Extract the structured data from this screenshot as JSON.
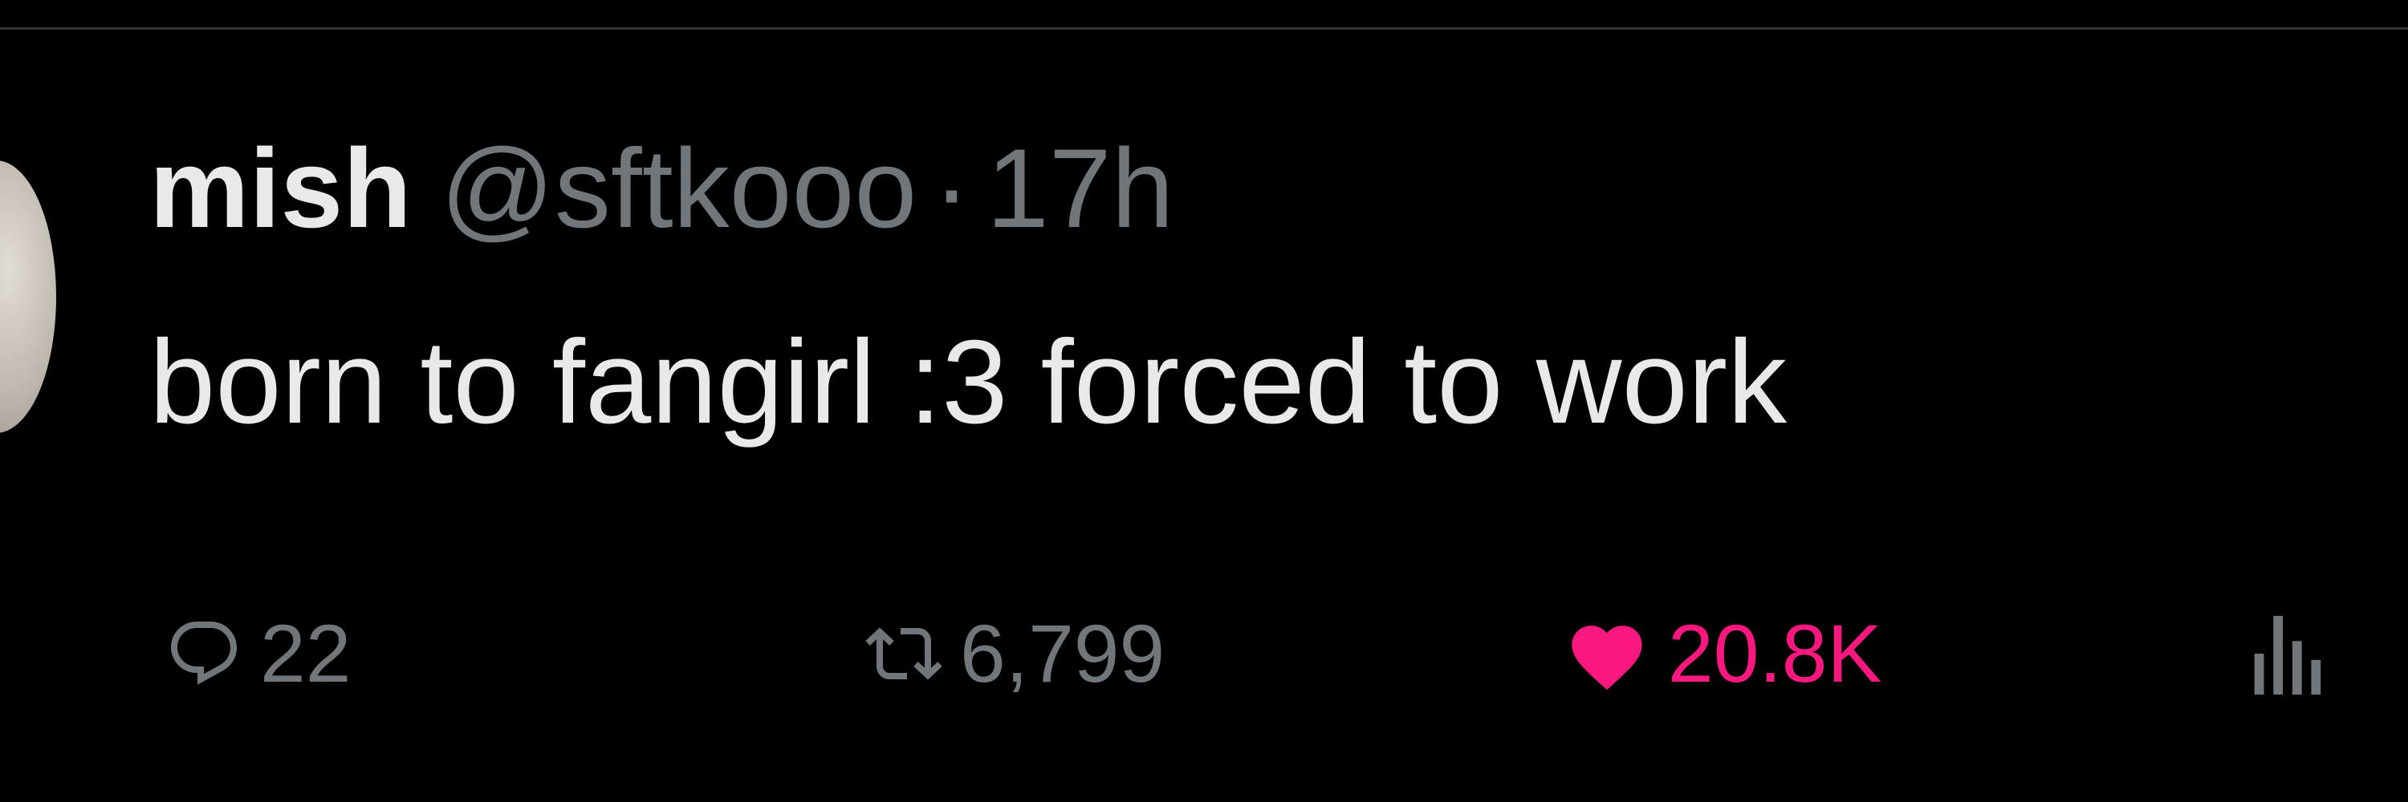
{
  "tweet": {
    "author": {
      "display_name": "mish",
      "handle": "@sftkooo"
    },
    "separator": "·",
    "timestamp": "17h",
    "text": "born to fangirl :3 forced to work"
  },
  "actions": {
    "reply": {
      "icon": "speech-bubble-icon",
      "count": "22"
    },
    "retweet": {
      "icon": "retweet-arrows-icon",
      "count": "6,799"
    },
    "like": {
      "icon": "heart-icon",
      "count": "20.8K",
      "active": true,
      "color": "#f91880"
    },
    "views": {
      "icon": "bar-chart-icon"
    }
  },
  "colors": {
    "background": "#000000",
    "primary_text": "#e7e9ea",
    "secondary_text": "#71767b",
    "like_pink": "#f91880"
  }
}
